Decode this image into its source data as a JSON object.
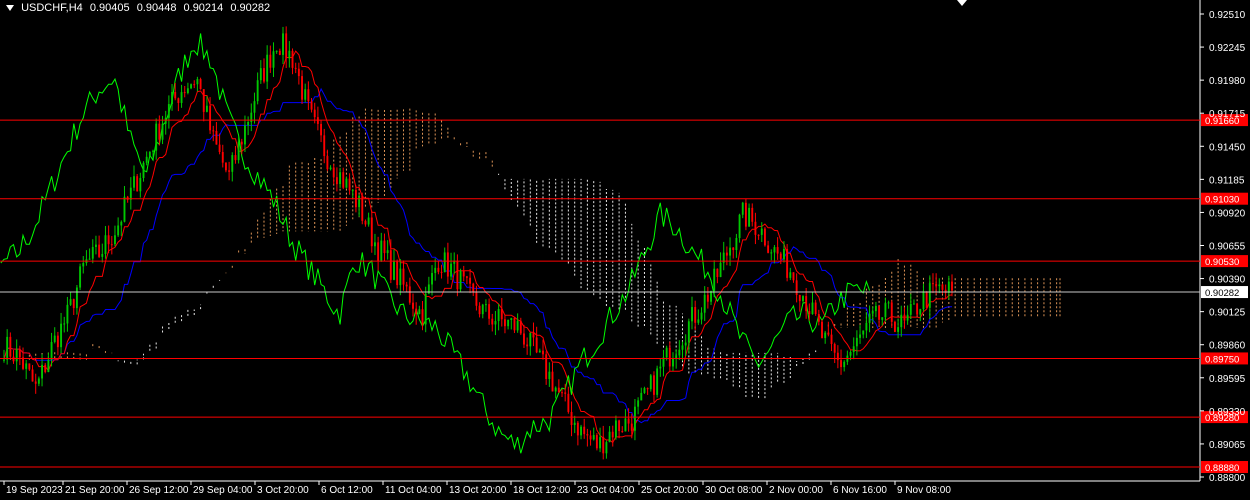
{
  "header": {
    "symbol": "USDCHF,H4",
    "open": "0.90405",
    "high": "0.90448",
    "low": "0.90214",
    "close": "0.90282"
  },
  "colors": {
    "background": "#000000",
    "bull": "#00c800",
    "bear": "#ff0000",
    "tenkan": "#ff0000",
    "kijun": "#0000ff",
    "chikou": "#00ff00",
    "cloud_bull": "#f4a460",
    "cloud_bear": "#ffffff",
    "level_line": "#ff0000",
    "price_line": "#c8c8c8",
    "axis": "#ffffff"
  },
  "chart_data": {
    "type": "candlestick",
    "instrument": "USDCHF",
    "timeframe": "H4",
    "ylim": [
      0.888,
      0.9251
    ],
    "y_ticks": [
      "0.92510",
      "0.92245",
      "0.91980",
      "0.91715",
      "0.91450",
      "0.91185",
      "0.90920",
      "0.90655",
      "0.90390",
      "0.90125",
      "0.89860",
      "0.89595",
      "0.89330",
      "0.89065",
      "0.88800"
    ],
    "x_ticks": [
      "19 Sep 2023",
      "21 Sep 20:00",
      "26 Sep 12:00",
      "29 Sep 04:00",
      "3 Oct 20:00",
      "6 Oct 12:00",
      "11 Oct 04:00",
      "13 Oct 20:00",
      "18 Oct 12:00",
      "23 Oct 04:00",
      "25 Oct 20:00",
      "30 Oct 08:00",
      "2 Nov 00:00",
      "6 Nov 16:00",
      "9 Nov 08:00"
    ],
    "horizontal_levels": [
      {
        "label": "0.91660",
        "value": 0.9166
      },
      {
        "label": "0.91030",
        "value": 0.9103
      },
      {
        "label": "0.90530",
        "value": 0.9053
      },
      {
        "label": "0.89750",
        "value": 0.8975
      },
      {
        "label": "0.89280",
        "value": 0.8928
      },
      {
        "label": "0.88880",
        "value": 0.8888
      }
    ],
    "current_price": {
      "label": "0.90282",
      "value": 0.90282
    },
    "close_path": [
      [
        0,
        0.8985
      ],
      [
        1,
        0.8975
      ],
      [
        2,
        0.895
      ],
      [
        3,
        0.8985
      ],
      [
        4,
        0.901
      ],
      [
        5,
        0.905
      ],
      [
        6,
        0.906
      ],
      [
        7,
        0.908
      ],
      [
        8,
        0.911
      ],
      [
        9,
        0.914
      ],
      [
        10,
        0.917
      ],
      [
        11,
        0.919
      ],
      [
        12,
        0.92
      ],
      [
        13,
        0.915
      ],
      [
        14,
        0.912
      ],
      [
        15,
        0.916
      ],
      [
        16,
        0.92
      ],
      [
        17,
        0.923
      ],
      [
        18,
        0.9215
      ],
      [
        19,
        0.917
      ],
      [
        20,
        0.914
      ],
      [
        21,
        0.912
      ],
      [
        22,
        0.91
      ],
      [
        23,
        0.907
      ],
      [
        24,
        0.905
      ],
      [
        25,
        0.903
      ],
      [
        26,
        0.901
      ],
      [
        27,
        0.9055
      ],
      [
        28,
        0.9045
      ],
      [
        29,
        0.9025
      ],
      [
        30,
        0.901
      ],
      [
        31,
        0.9005
      ],
      [
        32,
        0.9
      ],
      [
        33,
        0.898
      ],
      [
        34,
        0.896
      ],
      [
        35,
        0.8935
      ],
      [
        36,
        0.8915
      ],
      [
        37,
        0.8905
      ],
      [
        38,
        0.892
      ],
      [
        39,
        0.8925
      ],
      [
        40,
        0.8945
      ],
      [
        41,
        0.897
      ],
      [
        42,
        0.899
      ],
      [
        43,
        0.901
      ],
      [
        44,
        0.903
      ],
      [
        45,
        0.906
      ],
      [
        46,
        0.909
      ],
      [
        47,
        0.908
      ],
      [
        48,
        0.906
      ],
      [
        49,
        0.9045
      ],
      [
        50,
        0.902
      ],
      [
        51,
        0.899
      ],
      [
        52,
        0.897
      ],
      [
        53,
        0.8985
      ],
      [
        54,
        0.9005
      ],
      [
        55,
        0.901
      ],
      [
        56,
        0.9
      ],
      [
        57,
        0.902
      ],
      [
        58,
        0.903
      ],
      [
        59,
        0.9028
      ]
    ]
  }
}
